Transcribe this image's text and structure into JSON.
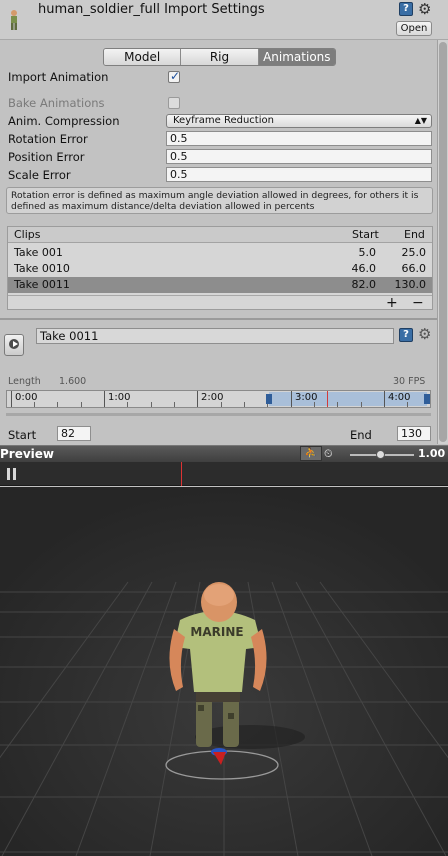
{
  "header": {
    "title": "human_soldier_full Import Settings",
    "help_glyph": "?",
    "gear_glyph": "⚙",
    "open_label": "Open"
  },
  "tabs": [
    {
      "label": "Model",
      "active": false
    },
    {
      "label": "Rig",
      "active": false
    },
    {
      "label": "Animations",
      "active": true
    }
  ],
  "settings": {
    "import_animation": {
      "label": "Import Animation",
      "checked": true
    },
    "bake_animations": {
      "label": "Bake Animations",
      "checked": false,
      "disabled": true
    },
    "anim_compression": {
      "label": "Anim. Compression",
      "value": "Keyframe Reduction"
    },
    "rotation_error": {
      "label": "Rotation Error",
      "value": "0.5"
    },
    "position_error": {
      "label": "Position Error",
      "value": "0.5"
    },
    "scale_error": {
      "label": "Scale Error",
      "value": "0.5"
    },
    "help_text": "Rotation error is defined as maximum angle deviation allowed in degrees, for others it is defined as maximum distance/delta deviation allowed in percents"
  },
  "clips": {
    "headers": {
      "name": "Clips",
      "start": "Start",
      "end": "End"
    },
    "rows": [
      {
        "name": "Take 001",
        "start": "5.0",
        "end": "25.0",
        "selected": false
      },
      {
        "name": "Take 0010",
        "start": "46.0",
        "end": "66.0",
        "selected": false
      },
      {
        "name": "Take 0011",
        "start": "82.0",
        "end": "130.0",
        "selected": true
      }
    ],
    "add_label": "+",
    "remove_label": "−"
  },
  "clip_editor": {
    "name": "Take 0011",
    "length_label": "Length",
    "length_value": "1.600",
    "fps": "30 FPS",
    "ticks": [
      "0:00",
      "1:00",
      "2:00",
      "3:00",
      "4:00"
    ],
    "selection_start_frame": 82,
    "selection_end_frame": 130,
    "start_label": "Start",
    "start_value": "82",
    "end_label": "End",
    "end_value": "130"
  },
  "preview": {
    "title": "Preview",
    "speed_value": "1.00",
    "speed_fraction": 0.45,
    "shirt_text": "MARINE"
  },
  "colors": {
    "accent_blue": "#3a6ea5",
    "selection_range": "#a9bfd9",
    "timeline_cursor": "#d23b3b",
    "viewport_bg": "#303030"
  }
}
